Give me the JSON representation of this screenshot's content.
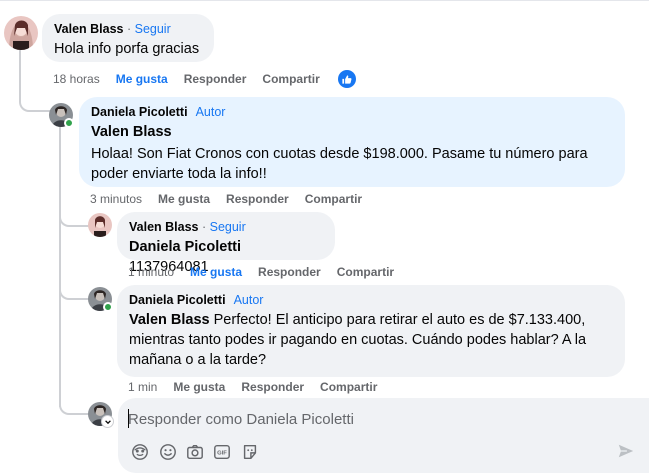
{
  "comments": [
    {
      "author": "Valen Blass",
      "follow": "Seguir",
      "text": "Hola info porfa gracias",
      "time": "18 horas",
      "like": "Me gusta",
      "reply": "Responder",
      "share": "Compartir"
    },
    {
      "author": "Daniela Picoletti",
      "badge": "Autor",
      "mention": "Valen Blass",
      "text": "Holaa! Son Fiat Cronos con cuotas desde $198.000. Pasame tu número para poder enviarte toda la info!!",
      "time": "3 minutos",
      "like": "Me gusta",
      "reply": "Responder",
      "share": "Compartir"
    },
    {
      "author": "Valen Blass",
      "follow": "Seguir",
      "mention": "Daniela Picoletti",
      "text": "1137964081",
      "time": "1 minuto",
      "like": "Me gusta",
      "reply": "Responder",
      "share": "Compartir"
    },
    {
      "author": "Daniela Picoletti",
      "badge": "Autor",
      "mention": "Valen Blass",
      "text": "Perfecto! El anticipo para retirar el auto es de $7.133.400, mientras tanto podes ir pagando en cuotas. Cuándo podes hablar? A la mañana o a la tarde?",
      "time": "1 min",
      "like": "Me gusta",
      "reply": "Responder",
      "share": "Compartir"
    }
  ],
  "composer": {
    "placeholder": "Responder como Daniela Picoletti",
    "tools": [
      "avatar-sticker-icon",
      "emoji-icon",
      "camera-icon",
      "gif-icon",
      "sticker-icon"
    ],
    "send_icon": "send-icon"
  },
  "colors": {
    "accent": "#1877f2",
    "bubble": "#f0f2f5",
    "bubble_self": "#e7f3ff",
    "muted": "#65676b",
    "online": "#31a24c"
  }
}
